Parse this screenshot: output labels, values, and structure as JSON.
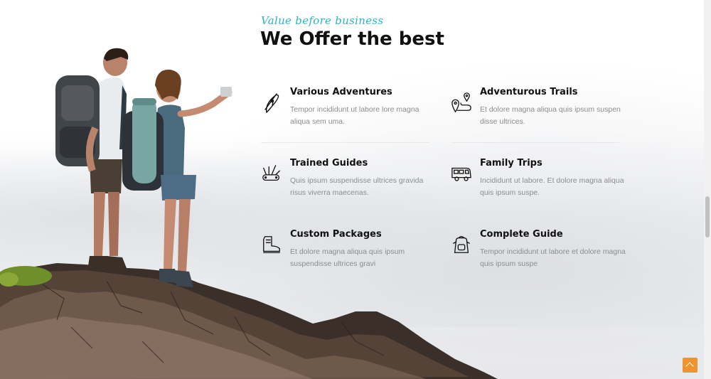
{
  "section": {
    "eyebrow": "Value before business",
    "title": "We Offer the best"
  },
  "features": [
    {
      "title": "Various Adventures",
      "desc": "Tempor incididunt ut labore lore magna aliqua sem uma.",
      "icon": "kayak-icon"
    },
    {
      "title": "Adventurous Trails",
      "desc": "Et dolore magna aliqua quis ipsum suspen disse ultrices.",
      "icon": "map-trail-icon"
    },
    {
      "title": "Trained Guides",
      "desc": "Quis ipsum suspendisse ultrices gravida risus viverra maecenas.",
      "icon": "multitool-icon"
    },
    {
      "title": "Family Trips",
      "desc": "Incididunt ut labore. Et dolore magna aliqua quis ipsum suspe.",
      "icon": "camper-van-icon"
    },
    {
      "title": "Custom Packages",
      "desc": "Et dolore magna aliqua quis ipsum suspendisse ultrices gravi",
      "icon": "hiking-boot-icon"
    },
    {
      "title": "Complete Guide",
      "desc": "Tempor incididunt ut labore et dolore magna quis ipsum suspe",
      "icon": "backpack-icon"
    }
  ],
  "colors": {
    "accent": "#2bb6c7",
    "scroll_button": "#f0922e",
    "text": "#111111",
    "muted": "#8a8d91"
  },
  "scroll_top": {
    "icon": "chevron-up-icon"
  }
}
